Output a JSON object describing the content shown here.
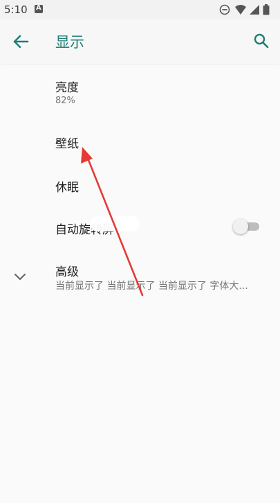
{
  "status_bar": {
    "time": "5:10",
    "app_badge": "A",
    "icons": [
      "do-not-disturb-icon",
      "wifi-icon",
      "signal-icon",
      "battery-icon"
    ]
  },
  "app_bar": {
    "title": "显示",
    "back_icon": "arrow-left-icon",
    "search_icon": "search-icon"
  },
  "settings": {
    "brightness": {
      "title": "亮度",
      "value": "82%"
    },
    "wallpaper": {
      "title": "壁纸"
    },
    "sleep": {
      "title": "休眠"
    },
    "auto_rotate": {
      "title": "自动旋转屏",
      "enabled": false
    },
    "advanced": {
      "title": "高级",
      "summary": "当前显示了 当前显示了 当前显示了 字体大..."
    }
  },
  "colors": {
    "accent": "#1d7f74",
    "annotation_arrow": "#e53935"
  }
}
